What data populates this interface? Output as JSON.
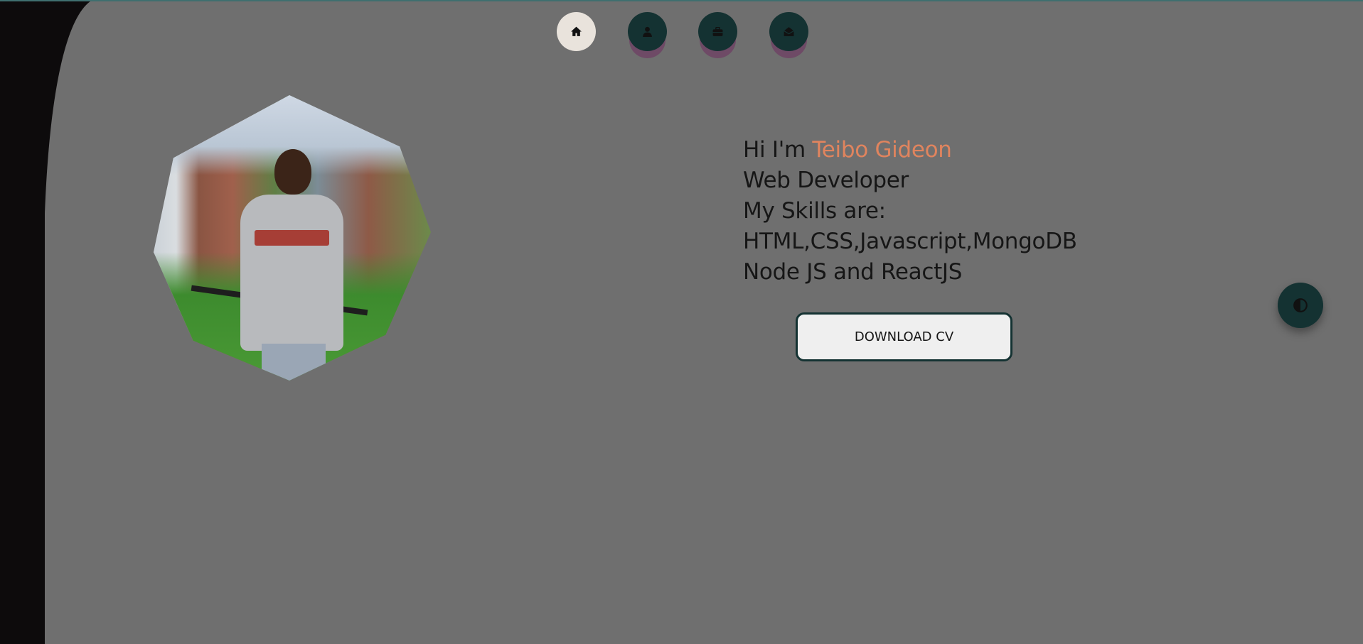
{
  "nav": {
    "items": [
      {
        "icon": "home-icon",
        "active": true
      },
      {
        "icon": "user-icon",
        "active": false
      },
      {
        "icon": "briefcase-icon",
        "active": false
      },
      {
        "icon": "envelope-icon",
        "active": false
      }
    ]
  },
  "hero": {
    "greeting": "Hi I'm ",
    "name": "Teibo Gideon",
    "role": "Web Developer",
    "skills_heading": "My Skills are:",
    "skills_line1": "HTML,CSS,Javascript,MongoDB",
    "skills_line2": "Node JS and ReactJS",
    "cv_button": "DOWNLOAD CV"
  },
  "theme_toggle": {
    "icon": "contrast-icon"
  },
  "colors": {
    "background": "#6f6f6f",
    "sidebar": "#0d0b0c",
    "accent_name": "#e0845e",
    "nav_dark": "#143232",
    "nav_active": "#e9e3dc"
  }
}
